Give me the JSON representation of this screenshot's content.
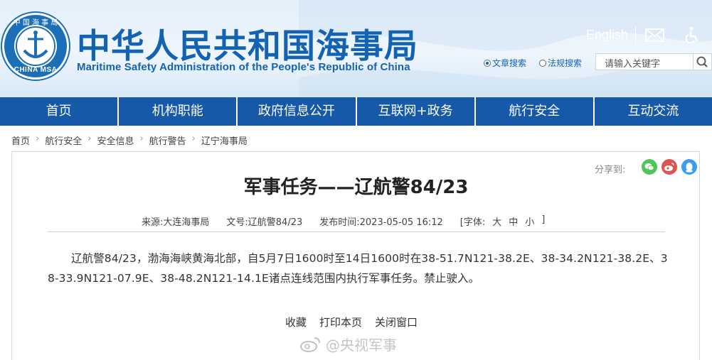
{
  "header": {
    "logo": {
      "top_text": "中 国 海 事 局",
      "bottom_text": "CHINA MSA"
    },
    "site_title_cn": "中华人民共和国海事局",
    "site_title_en": "Maritime Safety Administration of the People's Republic of China",
    "language_link": "English",
    "icons": [
      "mail-icon",
      "accessibility-icon"
    ],
    "search": {
      "options": [
        {
          "label": "文章搜索",
          "selected": true
        },
        {
          "label": "法规搜索",
          "selected": false
        }
      ],
      "placeholder": "请输入关键字"
    }
  },
  "nav": {
    "items": [
      "首页",
      "机构职能",
      "政府信息公开",
      "互联网+政务",
      "航行安全",
      "互动交流"
    ]
  },
  "breadcrumb": [
    "首页",
    "航行安全",
    "安全信息",
    "航行警告",
    "辽宁海事局"
  ],
  "share": {
    "label": "分享到:",
    "targets": [
      "wechat-icon",
      "weibo-icon",
      "qq-icon"
    ]
  },
  "article": {
    "title": "军事任务——辽航警84/23",
    "meta": {
      "source": "来源:大连海事局",
      "doc_no": "文号:辽航警84/23",
      "publish_time": "发布时间:2023-05-05 16:12",
      "font_label": "[字体:",
      "font_sizes": [
        "大",
        "中",
        "小"
      ],
      "font_close": "]"
    },
    "body": "辽航警84/23，渤海海峡黄海北部，自5月7日1600时至14日1600时在38-51.7N121-38.2E、38-34.2N121-38.2E、38-33.9N121-07.9E、38-48.2N121-14.1E诸点连线范围内执行军事任务。禁止驶入。"
  },
  "actions": [
    "收藏",
    "打印本页",
    "关闭窗口"
  ],
  "watermark": "@央视军事",
  "colors": {
    "brand_blue": "#1559a8",
    "title_blue": "#1463b3"
  }
}
